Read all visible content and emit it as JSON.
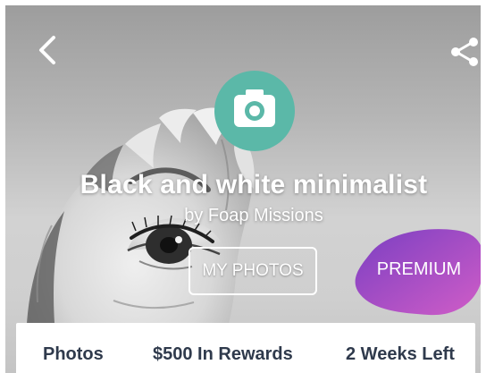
{
  "mission": {
    "title": "Black and white minimalist",
    "subtitle": "by Foap Missions"
  },
  "actions": {
    "my_photos_label": "MY PHOTOS",
    "premium_label": "PREMIUM"
  },
  "stats": {
    "photos": "Photos",
    "rewards": "$500 In Rewards",
    "time_left": "2 Weeks Left"
  },
  "icons": {
    "back": "chevron-left-icon",
    "share": "share-icon",
    "mission": "camera-icon"
  },
  "colors": {
    "icon_circle": "#5bb8a8",
    "premium_start": "#7a3fc2",
    "premium_end": "#d15dc7",
    "stats_text": "#2f3a4c",
    "overlay_text": "#ffffff"
  }
}
